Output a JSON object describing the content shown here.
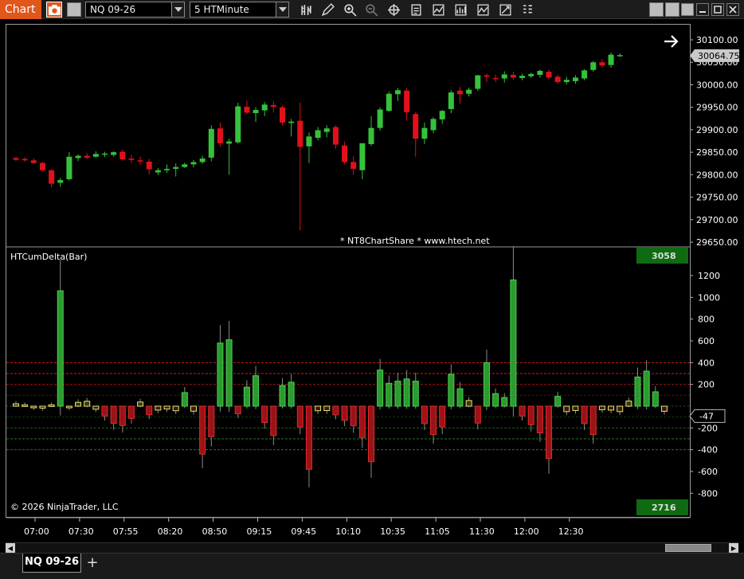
{
  "app": {
    "tab_label": "Chart"
  },
  "toolbar": {
    "instrument": "NQ 09-26",
    "interval": "5 HTMinute",
    "icons": [
      "bars-icon",
      "pencil-icon",
      "zoom-in-icon",
      "zoom-out-icon",
      "crosshair-icon",
      "properties-icon",
      "indicators-icon",
      "strategies-icon",
      "templates-icon",
      "global-draw-icon",
      "grid-icon"
    ]
  },
  "window_controls": [
    "tile-icon",
    "minimize-icon",
    "maximize-icon",
    "close-icon"
  ],
  "price_panel": {
    "current_price": "30064.75",
    "y_ticks": [
      "30100.00",
      "30050.00",
      "30000.00",
      "29950.00",
      "29900.00",
      "29850.00",
      "29800.00",
      "29750.00",
      "29700.00",
      "29650.00"
    ],
    "watermark": "* NT8ChartShare *     www.htech.net"
  },
  "delta_panel": {
    "title": "HTCumDelta(Bar)",
    "max_badge": "3058",
    "min_badge": "2716",
    "current_value": "-47",
    "y_ticks": [
      "1200",
      "1000",
      "800",
      "600",
      "400",
      "200",
      "-200",
      "-400",
      "-600",
      "-800"
    ],
    "copyright": "© 2026 NinjaTrader, LLC"
  },
  "x_ticks": [
    "07:00",
    "07:30",
    "07:55",
    "08:20",
    "08:50",
    "09:15",
    "09:45",
    "10:10",
    "10:35",
    "11:05",
    "11:30",
    "12:00",
    "12:30"
  ],
  "colors": {
    "up": "#35c23a",
    "down": "#e0111b",
    "delta_up": "#2c9a2f",
    "delta_down": "#9b1217",
    "doji": "#e6e66b",
    "badge": "#0f6b12",
    "price_marker": "#c9c9c9",
    "accent": "#e0561b"
  },
  "bottom": {
    "instrument_tab": "NQ 09-26",
    "add_tab": "+"
  },
  "chart_data": [
    {
      "type": "candlestick",
      "title": "NQ 09-26 5 HTMinute",
      "x_ticks": [
        "07:00",
        "07:30",
        "07:55",
        "08:20",
        "08:50",
        "09:15",
        "09:45",
        "10:10",
        "10:35",
        "11:05",
        "11:30",
        "12:00",
        "12:30"
      ],
      "ylim": [
        29640,
        30115
      ],
      "grid": false,
      "ohlc": [
        [
          29837,
          29840,
          29830,
          29833
        ],
        [
          29835,
          29839,
          29829,
          29832
        ],
        [
          29832,
          29836,
          29824,
          29826
        ],
        [
          29826,
          29829,
          29807,
          29810
        ],
        [
          29810,
          29812,
          29772,
          29780
        ],
        [
          29782,
          29793,
          29773,
          29788
        ],
        [
          29790,
          29850,
          29787,
          29840
        ],
        [
          29837,
          29845,
          29830,
          29842
        ],
        [
          29842,
          29848,
          29834,
          29838
        ],
        [
          29840,
          29852,
          29838,
          29846
        ],
        [
          29845,
          29851,
          29839,
          29847
        ],
        [
          29844,
          29852,
          29840,
          29850
        ],
        [
          29851,
          29856,
          29831,
          29834
        ],
        [
          29836,
          29844,
          29826,
          29833
        ],
        [
          29832,
          29840,
          29822,
          29831
        ],
        [
          29829,
          29835,
          29800,
          29812
        ],
        [
          29805,
          29815,
          29799,
          29810
        ],
        [
          29810,
          29823,
          29804,
          29813
        ],
        [
          29813,
          29825,
          29796,
          29817
        ],
        [
          29817,
          29827,
          29815,
          29823
        ],
        [
          29823,
          29833,
          29816,
          29828
        ],
        [
          29828,
          29842,
          29824,
          29836
        ],
        [
          29838,
          29910,
          29830,
          29902
        ],
        [
          29903,
          29916,
          29862,
          29870
        ],
        [
          29869,
          29880,
          29800,
          29874
        ],
        [
          29872,
          29960,
          29869,
          29952
        ],
        [
          29951,
          29965,
          29934,
          29938
        ],
        [
          29937,
          29950,
          29917,
          29944
        ],
        [
          29943,
          29962,
          29930,
          29956
        ],
        [
          29955,
          29963,
          29938,
          29951
        ],
        [
          29950,
          29954,
          29910,
          29916
        ],
        [
          29915,
          29924,
          29885,
          29918
        ],
        [
          29920,
          29960,
          29676,
          29862
        ],
        [
          29863,
          29894,
          29826,
          29885
        ],
        [
          29882,
          29906,
          29876,
          29899
        ],
        [
          29895,
          29910,
          29883,
          29903
        ],
        [
          29906,
          29910,
          29858,
          29867
        ],
        [
          29865,
          29874,
          29823,
          29828
        ],
        [
          29828,
          29841,
          29800,
          29813
        ],
        [
          29810,
          29860,
          29790,
          29870
        ],
        [
          29868,
          29930,
          29864,
          29904
        ],
        [
          29904,
          29950,
          29898,
          29945
        ],
        [
          29942,
          29985,
          29940,
          29980
        ],
        [
          29979,
          29993,
          29964,
          29988
        ],
        [
          29987,
          29992,
          29920,
          29939
        ],
        [
          29935,
          29940,
          29840,
          29880
        ],
        [
          29880,
          29916,
          29868,
          29904
        ],
        [
          29899,
          29928,
          29892,
          29924
        ],
        [
          29923,
          29944,
          29913,
          29942
        ],
        [
          29946,
          29988,
          29937,
          29983
        ],
        [
          29987,
          29995,
          29958,
          29979
        ],
        [
          29980,
          29994,
          29974,
          29989
        ],
        [
          29991,
          30022,
          29986,
          30021
        ],
        [
          30021,
          30025,
          30006,
          30018
        ],
        [
          30015,
          30023,
          30006,
          30014
        ],
        [
          30014,
          30030,
          30005,
          30023
        ],
        [
          30022,
          30029,
          30012,
          30016
        ],
        [
          30015,
          30025,
          30010,
          30020
        ],
        [
          30019,
          30027,
          30015,
          30024
        ],
        [
          30022,
          30034,
          30016,
          30031
        ],
        [
          30029,
          30034,
          30012,
          30016
        ],
        [
          30018,
          30023,
          30002,
          30006
        ],
        [
          30006,
          30018,
          30001,
          30011
        ],
        [
          30008,
          30021,
          30002,
          30016
        ],
        [
          30014,
          30035,
          30010,
          30032
        ],
        [
          30033,
          30053,
          30029,
          30050
        ],
        [
          30050,
          30057,
          30038,
          30043
        ],
        [
          30044,
          30072,
          30038,
          30067
        ],
        [
          30066,
          30070,
          30062,
          30066
        ]
      ]
    },
    {
      "type": "bar",
      "title": "HTCumDelta(Bar)",
      "ylim": [
        -890,
        1310
      ],
      "reference_lines": [
        400,
        300,
        200,
        100,
        -100,
        -200,
        -300,
        -400
      ],
      "values": [
        22,
        12,
        -12,
        -18,
        12,
        1060,
        -12,
        35,
        45,
        -28,
        -90,
        -158,
        -178,
        -112,
        38,
        -78,
        -36,
        -26,
        -42,
        125,
        -46,
        -440,
        -280,
        580,
        610,
        -70,
        175,
        280,
        -150,
        -270,
        190,
        220,
        -190,
        -580,
        -42,
        -40,
        -80,
        -130,
        -180,
        -290,
        -510,
        332,
        210,
        230,
        250,
        230,
        -160,
        -260,
        -190,
        292,
        160,
        52,
        -155,
        400,
        115,
        80,
        1160,
        -90,
        -170,
        -245,
        -480,
        90,
        -50,
        -40,
        -160,
        -260,
        -32,
        -36,
        -50,
        47,
        268,
        322,
        132,
        -47
      ]
    }
  ]
}
